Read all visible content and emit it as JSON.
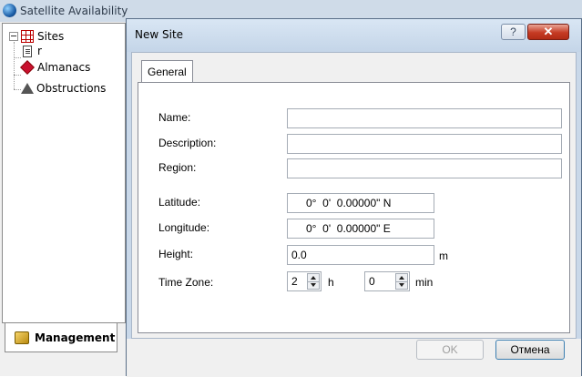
{
  "app": {
    "title": "Satellite Availability",
    "tree": {
      "sites_label": "Sites",
      "site_item_label": "r",
      "almanacs_label": "Almanacs",
      "obstructions_label": "Obstructions"
    },
    "management_tab_label": "Management"
  },
  "dialog": {
    "title": "New Site",
    "help_glyph": "?",
    "close_glyph": "✕",
    "tab_general_label": "General",
    "fields": {
      "name_label": "Name:",
      "name_value": "",
      "description_label": "Description:",
      "description_value": "",
      "region_label": "Region:",
      "region_value": "",
      "latitude_label": "Latitude:",
      "latitude_value": "0°  0'  0.00000\" N",
      "longitude_label": "Longitude:",
      "longitude_value": "0°  0'  0.00000\" E",
      "height_label": "Height:",
      "height_value": "0.0",
      "height_unit": "m",
      "timezone_label": "Time Zone:",
      "timezone_hours": "2",
      "timezone_hours_unit": "h",
      "timezone_minutes": "0",
      "timezone_minutes_unit": "min"
    },
    "ok_label": "OK",
    "cancel_label": "Отмена"
  }
}
